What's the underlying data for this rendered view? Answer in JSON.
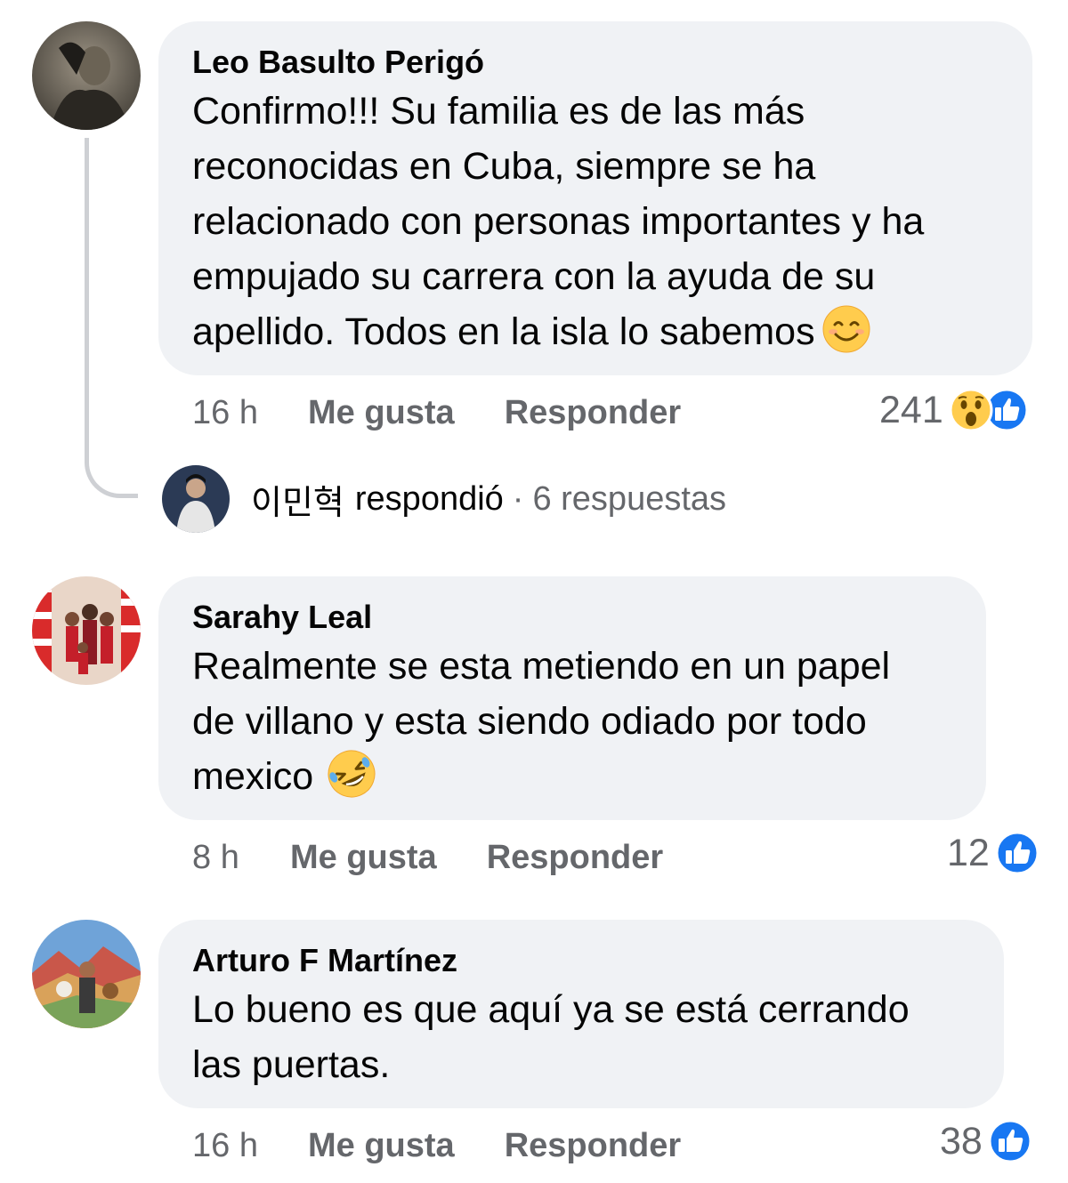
{
  "comments": [
    {
      "author": "Leo Basulto Perigó",
      "lines": [
        "Confirmo!!! Su familia es de las más",
        "reconocidas en Cuba, siempre se ha",
        "relacionado con personas importantes y ha",
        "empujado su carrera con la ayuda de su",
        "apellido. Todos en la isla lo sabemos"
      ],
      "emoji": "smiling-face-emoji",
      "time": "16 h",
      "like_label": "Me gusta",
      "reply_label": "Responder",
      "reaction_count": "241",
      "reaction_icons": [
        "wow-reaction-icon",
        "like-reaction-icon"
      ]
    },
    {
      "author": "Sarahy Leal",
      "lines": [
        "Realmente se esta metiendo en un papel",
        "de villano y esta siendo odiado por todo",
        "mexico"
      ],
      "emoji": "rolling-laughing-emoji",
      "time": "8 h",
      "like_label": "Me gusta",
      "reply_label": "Responder",
      "reaction_count": "12",
      "reaction_icons": [
        "like-reaction-icon"
      ]
    },
    {
      "author": "Arturo F Martínez",
      "lines": [
        "Lo bueno es que aquí ya se está cerrando",
        "las puertas."
      ],
      "time": "16 h",
      "like_label": "Me gusta",
      "reply_label": "Responder",
      "reaction_count": "38",
      "reaction_icons": [
        "like-reaction-icon"
      ]
    }
  ],
  "reply_summary": {
    "name": "이민혁",
    "verb": "respondió",
    "separator": "·",
    "count_text": "6 respuestas"
  },
  "colors": {
    "bubble": "#f0f2f5",
    "meta_text": "#65676b",
    "like_blue": "#1877f2",
    "emoji_yellow": "#ffcc4d",
    "thread_line": "#ced0d4"
  }
}
